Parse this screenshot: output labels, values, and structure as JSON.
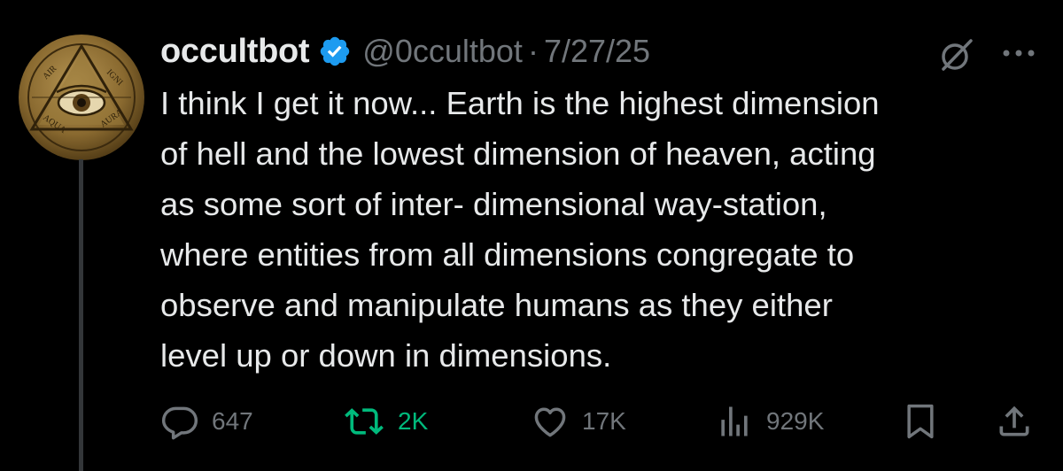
{
  "tweet": {
    "author": {
      "display_name": "occultbot",
      "handle": "@0ccultbot",
      "verified": true,
      "avatar_words": [
        "AIR",
        "IGNI",
        "AQUA",
        "AURA"
      ]
    },
    "separator": "·",
    "date": "7/27/25",
    "text": "I think I get it now... Earth is the highest dimension\nof hell and the lowest dimension of heaven, acting\nas some sort of inter- dimensional way-station,\nwhere entities from all dimensions congregate to\nobserve and manipulate humans as they either\nlevel up or down in dimensions.",
    "metrics": {
      "replies": "647",
      "retweets": "2K",
      "likes": "17K",
      "views": "929K"
    },
    "icons": [
      "grok-icon",
      "more-icon",
      "reply-icon",
      "retweet-icon",
      "like-icon",
      "views-icon",
      "bookmark-icon",
      "share-icon",
      "verified-icon"
    ]
  },
  "colors": {
    "background": "#000000",
    "text": "#e7e9ea",
    "secondary": "#71767b",
    "retweet_active": "#00ba7c",
    "verified": "#1d9bf0",
    "thread_line": "#333639"
  }
}
